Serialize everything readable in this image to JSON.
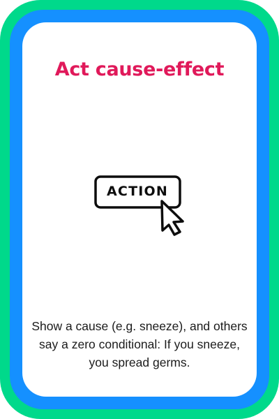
{
  "card": {
    "title": "Act cause-effect",
    "icon": {
      "name": "action-button-cursor-icon",
      "label": "ACTION"
    },
    "description": "Show a cause (e.g. sneeze), and others say a zero conditional: If you sneeze, you spread germs."
  },
  "colors": {
    "outer_border": "#00d98b",
    "inner_border": "#1590ff",
    "title": "#e0195a",
    "text": "#1b1b1b",
    "background": "#ffffff"
  }
}
